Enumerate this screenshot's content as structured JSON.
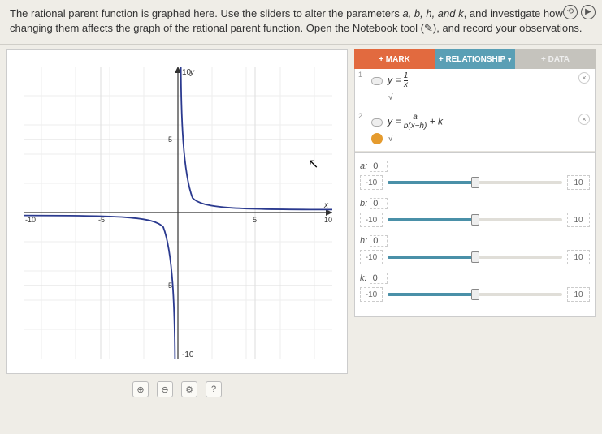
{
  "instructions": {
    "text_prefix": "The rational parent function is graphed here. Use the sliders to alter the parameters ",
    "params": "a, b, h, and k",
    "text_mid": ", and investigate how changing them affects the graph of the rational parent function. Open the Notebook tool (",
    "tool_glyph": "✎",
    "text_suffix": "), and record your observations."
  },
  "corner": {
    "rewind": "⟲",
    "play": "▶"
  },
  "graph": {
    "x_min": -10,
    "x_max": 10,
    "y_min": -10,
    "y_max": -10,
    "y_top_label": "10",
    "y_bottom_label": "-10",
    "x_left_label": "-10",
    "x_right_label": "10",
    "x_axis_label": "x",
    "y_axis_label": "y",
    "tick_minor": "5"
  },
  "toolbar": {
    "zoom_in": "⊕",
    "zoom_out": "⊖",
    "settings": "⚙",
    "help": "?"
  },
  "tabs": {
    "mark": "+ MARK",
    "relationship": "+ RELATIONSHIP",
    "rel_drop": "▾",
    "data": "+ DATA"
  },
  "functions": [
    {
      "num": "1",
      "color": "#2b3a8f",
      "formula_lhs": "y =",
      "frac_num": "1",
      "frac_den": "x",
      "radical": "√"
    },
    {
      "num": "2",
      "color": "#e59b2e",
      "formula_lhs": "y =",
      "frac_num": "a",
      "frac_den": "b(x−h)",
      "tail": " + k",
      "radical": "√"
    }
  ],
  "close_glyph": "×",
  "sliders": [
    {
      "name": "a",
      "value": "0",
      "min": "-10",
      "max": "10",
      "pct": 50
    },
    {
      "name": "b",
      "value": "0",
      "min": "-10",
      "max": "10",
      "pct": 50
    },
    {
      "name": "h",
      "value": "0",
      "min": "-10",
      "max": "10",
      "pct": 50
    },
    {
      "name": "k",
      "value": "0",
      "min": "-10",
      "max": "10",
      "pct": 50
    }
  ],
  "chart_data": {
    "type": "line",
    "title": "",
    "xlabel": "x",
    "ylabel": "y",
    "xlim": [
      -10,
      10
    ],
    "ylim": [
      -10,
      10
    ],
    "series": [
      {
        "name": "y = 1/x",
        "color": "#2b3a8f",
        "x": [
          -10,
          -5,
          -2,
          -1,
          -0.5,
          -0.2,
          0.2,
          0.5,
          1,
          2,
          5,
          10
        ],
        "y": [
          -0.1,
          -0.2,
          -0.5,
          -1,
          -2,
          -5,
          5,
          2,
          1,
          0.5,
          0.2,
          0.1
        ]
      },
      {
        "name": "y = a/(b(x-h)) + k",
        "color": "#e59b2e",
        "x": [],
        "y": []
      }
    ]
  }
}
